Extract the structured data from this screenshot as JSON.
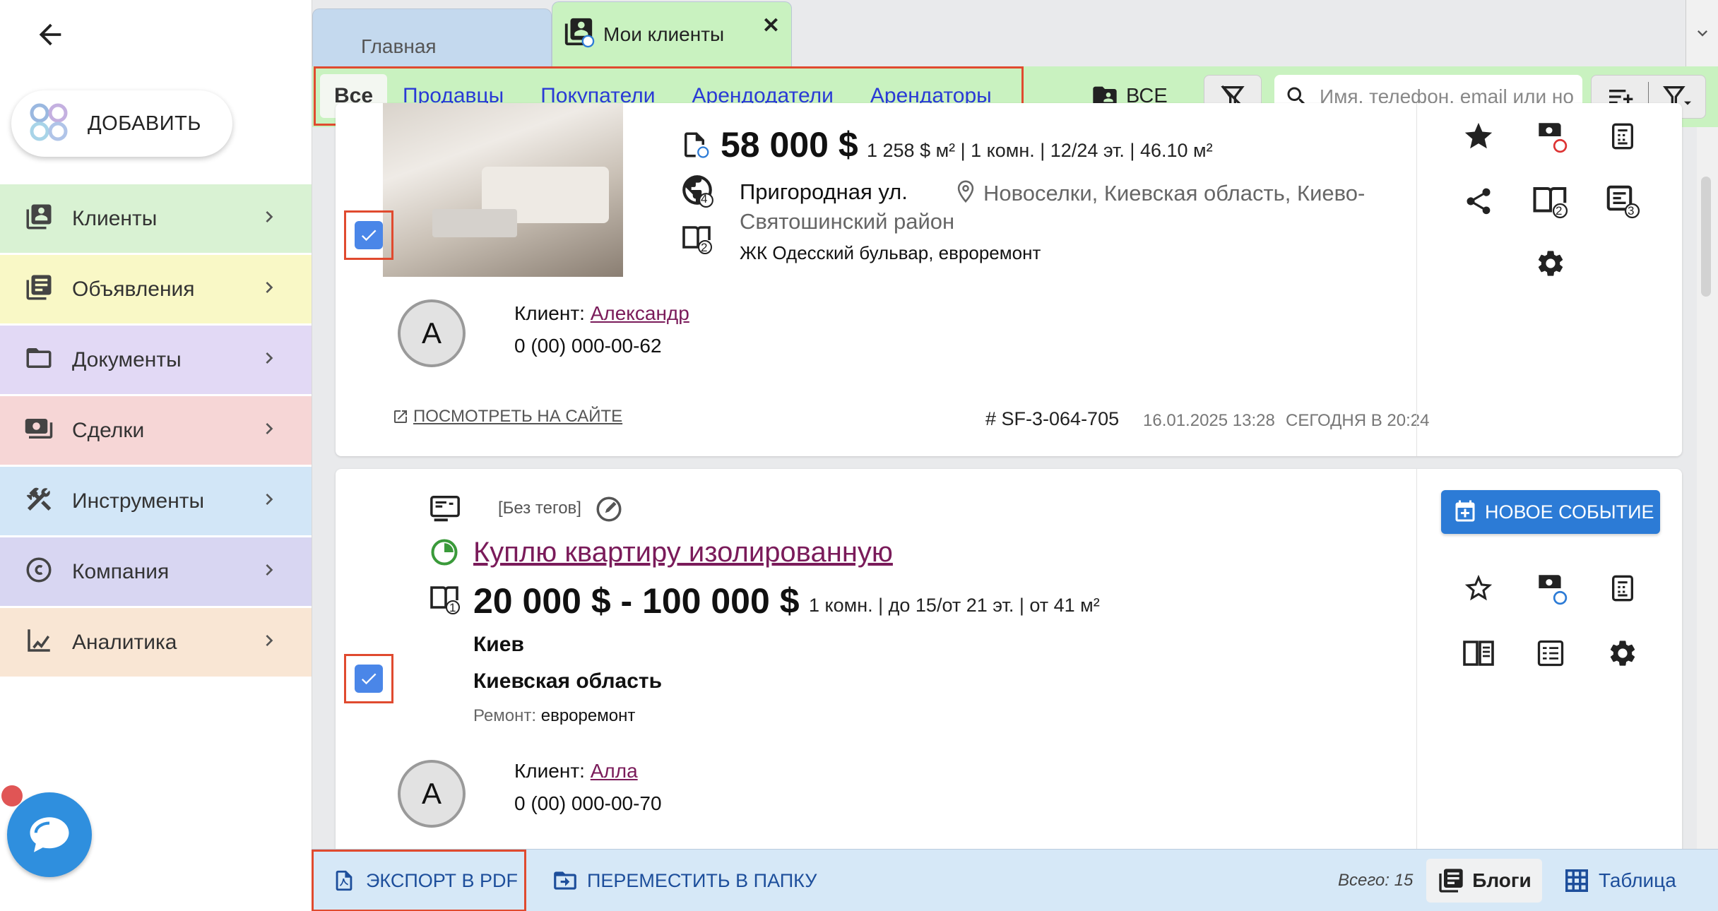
{
  "sidebar": {
    "add_label": "ДОБАВИТЬ",
    "items": [
      {
        "label": "Клиенты",
        "color": "#d9f2d3",
        "icon": "clients-icon"
      },
      {
        "label": "Объявления",
        "color": "#f9f8c6",
        "icon": "listings-icon"
      },
      {
        "label": "Документы",
        "color": "#e2d9f5",
        "icon": "folder-icon"
      },
      {
        "label": "Сделки",
        "color": "#f6d6d6",
        "icon": "deals-icon"
      },
      {
        "label": "Инструменты",
        "color": "#d2e6f7",
        "icon": "tools-icon"
      },
      {
        "label": "Компания",
        "color": "#d8d6f2",
        "icon": "company-icon"
      },
      {
        "label": "Аналитика",
        "color": "#f9e6d4",
        "icon": "analytics-icon"
      }
    ]
  },
  "tabs": {
    "home": "Главная",
    "clients": "Мои клиенты",
    "close": "✕"
  },
  "filters": {
    "all": "Все",
    "types": [
      "Продавцы",
      "Покупатели",
      "Арендодатели",
      "Арендаторы"
    ],
    "folder": "ВСЕ",
    "search_placeholder": "Имя, телефон, email или но"
  },
  "cards": [
    {
      "price": "58 000 $",
      "meta": "1 258 $ м² | 1 комн. | 12/24 эт. | 46.10 м²",
      "street": "Пригородная ул.",
      "location": "Новоселки, Киевская область, Киево-Святошинский район",
      "complex": "ЖК Одесский бульвар, евроремонт",
      "client_prefix": "Клиент:",
      "client_name": "Александр",
      "phone": "0 (00) 000-00-62",
      "avatar": "A",
      "view_on_site": "ПОСМОТРЕТЬ НА САЙТЕ",
      "code": "# SF-3-064-705",
      "created": "16.01.2025 13:28",
      "updated": "СЕГОДНЯ В 20:24",
      "badges": {
        "globe": "4",
        "doc": "2",
        "side_doc": "2",
        "side_list": "3"
      }
    },
    {
      "tags": "[Без тегов]",
      "title": "Куплю квартиру изолированную",
      "price": "20 000 $ - 100 000 $",
      "meta": "1 комн. | до 15/от 21 эт. | от 41 м²",
      "city": "Киев",
      "region": "Киевская область",
      "repair_label": "Ремонт:",
      "repair_value": "евроремонт",
      "client_prefix": "Клиент:",
      "client_name": "Алла",
      "phone": "0 (00) 000-00-70",
      "avatar": "A",
      "new_event": "НОВОЕ СОБЫТИЕ",
      "badges": {
        "doc": "1"
      }
    }
  ],
  "bottom": {
    "export": "ЭКСПОРТ В PDF",
    "move": "ПЕРЕМЕСТИТЬ В ПАПКУ",
    "total": "Всего: 15",
    "blogs": "Блоги",
    "table": "Таблица"
  },
  "colors": {
    "accent_green": "#c9f2c0",
    "highlight": "#e04a2f",
    "link": "#2a3ad6",
    "client_link": "#7a1b5a",
    "primary_blue": "#2c7bd6"
  }
}
